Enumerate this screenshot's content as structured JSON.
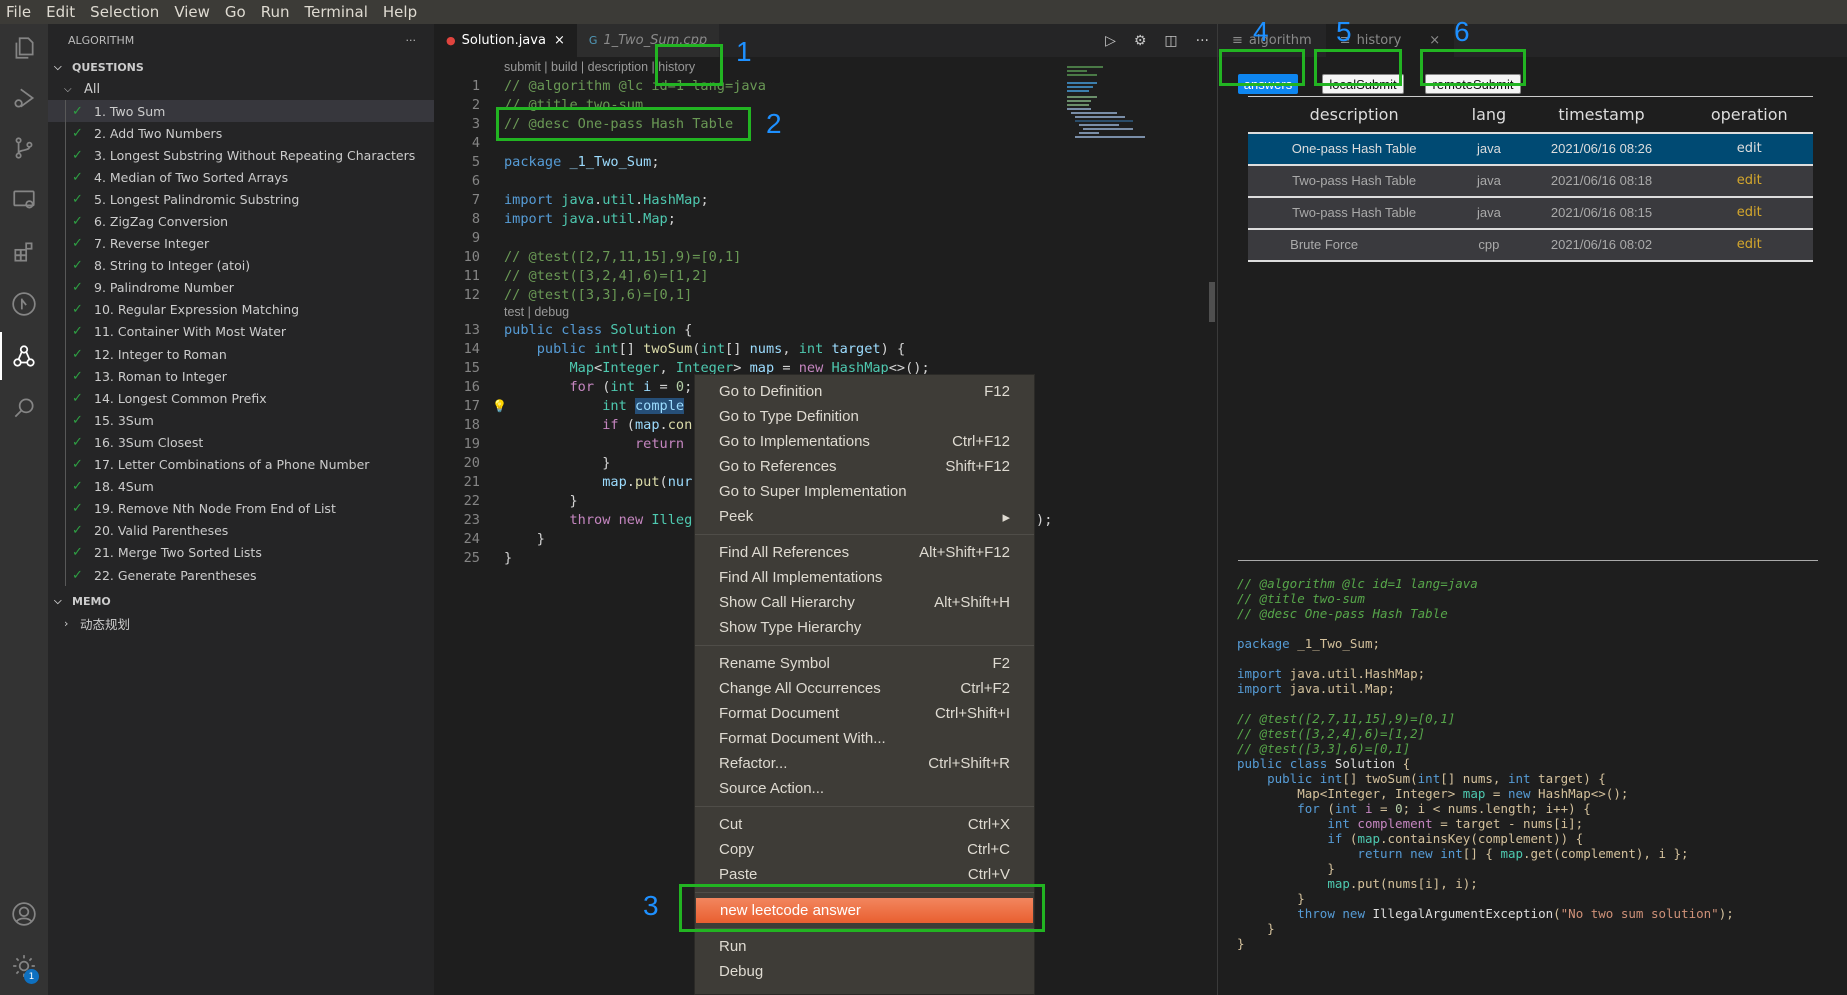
{
  "menubar": [
    "File",
    "Edit",
    "Selection",
    "View",
    "Go",
    "Run",
    "Terminal",
    "Help"
  ],
  "activity_bar": {
    "settings_badge": "1"
  },
  "sidebar": {
    "title": "ALGORITHM",
    "more": "···",
    "questions_header": "QUESTIONS",
    "all_label": "All",
    "questions": [
      "1. Two Sum",
      "2. Add Two Numbers",
      "3. Longest Substring Without Repeating Characters",
      "4. Median of Two Sorted Arrays",
      "5. Longest Palindromic Substring",
      "6. ZigZag Conversion",
      "7. Reverse Integer",
      "8. String to Integer (atoi)",
      "9. Palindrome Number",
      "10. Regular Expression Matching",
      "11. Container With Most Water",
      "12. Integer to Roman",
      "13. Roman to Integer",
      "14. Longest Common Prefix",
      "15. 3Sum",
      "16. 3Sum Closest",
      "17. Letter Combinations of a Phone Number",
      "18. 4Sum",
      "19. Remove Nth Node From End of List",
      "20. Valid Parentheses",
      "21. Merge Two Sorted Lists",
      "22. Generate Parentheses"
    ],
    "selected_index": 0,
    "memo_header": "MEMO",
    "memo_items": [
      "动态规划"
    ]
  },
  "editor": {
    "tabs": [
      {
        "label": "Solution.java",
        "close": "×",
        "active": true
      },
      {
        "label": "1_Two_Sum.cpp",
        "active": false
      }
    ],
    "codelens_top": "submit | build | description | history",
    "codelens_class": "test | debug",
    "lines": [
      {
        "n": "1",
        "html": "<span class='cm'>// @algorithm @lc id=1 lang=java</span>"
      },
      {
        "n": "2",
        "html": "<span class='cm'>// @title two-sum</span>"
      },
      {
        "n": "3",
        "html": "<span class='cm'>// @desc One-pass Hash Table</span>"
      },
      {
        "n": "4",
        "html": ""
      },
      {
        "n": "5",
        "html": "<span class='kw'>package</span> <span class='vr'>_1_Two_Sum</span><span class='pl'>;</span>"
      },
      {
        "n": "6",
        "html": ""
      },
      {
        "n": "7",
        "html": "<span class='kw'>import</span> <span class='ty'>java</span><span class='pl'>.</span><span class='ty'>util</span><span class='pl'>.</span><span class='ty'>HashMap</span><span class='pl'>;</span>"
      },
      {
        "n": "8",
        "html": "<span class='kw'>import</span> <span class='ty'>java</span><span class='pl'>.</span><span class='ty'>util</span><span class='pl'>.</span><span class='ty'>Map</span><span class='pl'>;</span>"
      },
      {
        "n": "9",
        "html": ""
      },
      {
        "n": "10",
        "html": "<span class='cm'>// @test([2,7,11,15],9)=[0,1]</span>"
      },
      {
        "n": "11",
        "html": "<span class='cm'>// @test([3,2,4],6)=[1,2]</span>"
      },
      {
        "n": "12",
        "html": "<span class='cm'>// @test([3,3],6)=[0,1]</span>"
      },
      {
        "lens": true
      },
      {
        "n": "13",
        "html": "<span class='kw'>public</span> <span class='kw'>class</span> <span class='ty'>Solution</span> <span class='pl'>{</span>"
      },
      {
        "n": "14",
        "html": "    <span class='kw'>public</span> <span class='ty'>int</span><span class='pl'>[]</span> <span class='fn'>twoSum</span><span class='pl'>(</span><span class='ty'>int</span><span class='pl'>[]</span> <span class='vr'>nums</span><span class='pl'>,</span> <span class='ty'>int</span> <span class='vr'>target</span><span class='pl'>) {</span>"
      },
      {
        "n": "15",
        "html": "        <span class='ty'>Map</span><span class='pl'>&lt;</span><span class='ty'>Integer</span><span class='pl'>,</span> <span class='ty'>Integer</span><span class='pl'>&gt;</span> <span class='vr'>map</span> <span class='pl'>=</span> <span class='ctl'>new</span> <span class='ty'>HashMap</span><span class='pl'>&lt;&gt;();</span>"
      },
      {
        "n": "16",
        "html": "        <span class='ctl'>for</span> <span class='pl'>(</span><span class='ty'>int</span> <span class='vr'>i</span> <span class='pl'>=</span> <span class='nm'>0</span><span class='pl'>;</span>"
      },
      {
        "n": "17",
        "html": "            <span class='ty'>int</span> <span class='vr sel-word'>comple</span>",
        "bulb": true
      },
      {
        "n": "18",
        "html": "            <span class='ctl'>if</span> <span class='pl'>(</span><span class='vr'>map</span><span class='pl'>.</span><span class='fn'>con</span>"
      },
      {
        "n": "19",
        "html": "                <span class='ctl'>return</span>"
      },
      {
        "n": "20",
        "html": "            <span class='pl'>}</span>"
      },
      {
        "n": "21",
        "html": "            <span class='vr'>map</span><span class='pl'>.</span><span class='fn'>put</span><span class='pl'>(</span><span class='vr'>nur</span>"
      },
      {
        "n": "22",
        "html": "        <span class='pl'>}</span>"
      },
      {
        "n": "23",
        "html": "        <span class='ctl'>throw</span> <span class='ctl'>new</span> <span class='ty'>Illeg</span>                                         <span class='str'>\"</span><span class='pl'>);</span>"
      },
      {
        "n": "24",
        "html": "    <span class='pl'>}</span>"
      },
      {
        "n": "25",
        "html": "<span class='pl'>}</span>"
      }
    ]
  },
  "context_menu": {
    "groups": [
      [
        {
          "label": "Go to Definition",
          "shortcut": "F12"
        },
        {
          "label": "Go to Type Definition",
          "shortcut": ""
        },
        {
          "label": "Go to Implementations",
          "shortcut": "Ctrl+F12"
        },
        {
          "label": "Go to References",
          "shortcut": "Shift+F12"
        },
        {
          "label": "Go to Super Implementation",
          "shortcut": ""
        },
        {
          "label": "Peek",
          "shortcut": "▸"
        }
      ],
      [
        {
          "label": "Find All References",
          "shortcut": "Alt+Shift+F12"
        },
        {
          "label": "Find All Implementations",
          "shortcut": ""
        },
        {
          "label": "Show Call Hierarchy",
          "shortcut": "Alt+Shift+H"
        },
        {
          "label": "Show Type Hierarchy",
          "shortcut": ""
        }
      ],
      [
        {
          "label": "Rename Symbol",
          "shortcut": "F2"
        },
        {
          "label": "Change All Occurrences",
          "shortcut": "Ctrl+F2"
        },
        {
          "label": "Format Document",
          "shortcut": "Ctrl+Shift+I"
        },
        {
          "label": "Format Document With...",
          "shortcut": ""
        },
        {
          "label": "Refactor...",
          "shortcut": "Ctrl+Shift+R"
        },
        {
          "label": "Source Action...",
          "shortcut": ""
        }
      ],
      [
        {
          "label": "Cut",
          "shortcut": "Ctrl+X"
        },
        {
          "label": "Copy",
          "shortcut": "Ctrl+C"
        },
        {
          "label": "Paste",
          "shortcut": "Ctrl+V"
        }
      ],
      [
        {
          "label": "new leetcode answer",
          "shortcut": "",
          "highlighted": true
        }
      ],
      [
        {
          "label": "Run",
          "shortcut": ""
        },
        {
          "label": "Debug",
          "shortcut": ""
        }
      ]
    ]
  },
  "annotations": [
    "1",
    "2",
    "3",
    "4",
    "5",
    "6"
  ],
  "right_panel": {
    "tabs": [
      {
        "label": "algorithm",
        "active": false
      },
      {
        "label": "history",
        "active": true,
        "close": "×"
      }
    ],
    "buttons": {
      "answers": "answers",
      "local": "localSubmit",
      "remote": "remoteSubmit"
    },
    "table": {
      "headers": [
        "description",
        "lang",
        "timestamp",
        "operation"
      ],
      "rows": [
        {
          "description": "One-pass Hash Table",
          "lang": "java",
          "timestamp": "2021/06/16 08:26",
          "operation": "edit",
          "selected": true
        },
        {
          "description": "Two-pass Hash Table",
          "lang": "java",
          "timestamp": "2021/06/16 08:18",
          "operation": "edit"
        },
        {
          "description": "Two-pass Hash Table",
          "lang": "java",
          "timestamp": "2021/06/16 08:15",
          "operation": "edit"
        },
        {
          "description": "Brute Force",
          "lang": "cpp",
          "timestamp": "2021/06/16 08:02",
          "operation": "edit"
        }
      ]
    },
    "preview_code": [
      "<span class='cm'>// @algorithm @lc id=1 lang=java</span>",
      "<span class='cm'>// @title two-sum</span>",
      "<span class='cm'>// @desc One-pass Hash Table</span>",
      "",
      "<span class='kw'>package</span> <span class='pl'>_1_Two_Sum;</span>",
      "",
      "<span class='kw'>import</span> <span class='pl'>java.util.HashMap;</span>",
      "<span class='kw'>import</span> <span class='pl'>java.util.Map;</span>",
      "",
      "<span class='cm'>// @test([2,7,11,15],9)=[0,1]</span>",
      "<span class='cm'>// @test([3,2,4],6)=[1,2]</span>",
      "<span class='cm'>// @test([3,3],6)=[0,1]</span>",
      "<span class='kw'>public</span> <span class='kw'>class</span> <span style='color:#ddd'>Solution</span> <span class='pl'>{</span>",
      "    <span class='kw'>public</span> <span class='kw'>int</span><span class='pl'>[] twoSum(</span><span class='kw'>int</span><span class='pl'>[] nums, </span><span class='kw'>int</span><span class='pl'> target) {</span>",
      "        <span class='pl'>Map&lt;Integer, Integer&gt; </span><span class='ty'>map</span><span class='pl'> = </span><span class='kw'>new</span><span class='pl'> HashMap&lt;&gt;();</span>",
      "        <span class='kw'>for</span><span class='pl'> (</span><span class='kw'>int</span> <span class='ctl'>i</span><span class='pl'> = </span><span class='nm'>0</span><span class='pl'>; i &lt; nums.length; i++) {</span>",
      "            <span class='kw'>int</span> <span class='ctl'>complement</span><span class='pl'> = target - nums[i];</span>",
      "            <span class='kw'>if</span><span class='pl'> (</span><span class='ty'>map</span><span class='pl'>.containsKey(complement)) {</span>",
      "                <span class='kw'>return</span> <span class='kw'>new</span> <span class='kw'>int</span><span class='pl'>[] { </span><span class='ty'>map</span><span class='pl'>.get(complement), i };</span>",
      "            <span class='pl'>}</span>",
      "            <span class='ty'>map</span><span class='pl'>.put(nums[i], i);</span>",
      "        <span class='pl'>}</span>",
      "        <span class='kw'>throw</span> <span class='kw'>new</span> <span style='color:#ddd'>IllegalArgumentException</span><span class='pl'>(</span><span class='str'>\"No two sum solution\"</span><span class='pl'>);</span>",
      "    <span class='pl'>}</span>",
      "<span class='pl'>}</span>"
    ]
  }
}
